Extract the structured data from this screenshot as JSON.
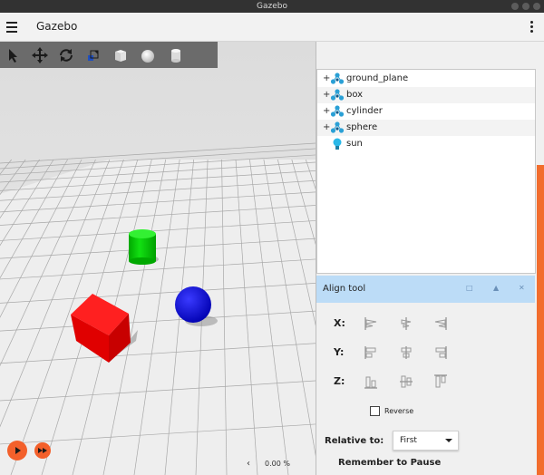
{
  "window": {
    "title": "Gazebo"
  },
  "app": {
    "name": "Gazebo"
  },
  "toolbar": {
    "tools": [
      "select-icon",
      "translate-icon",
      "rotate-icon",
      "scale-icon",
      "box-icon",
      "sphere-icon",
      "cylinder-icon"
    ]
  },
  "playback": {
    "rtf": "0.00 %",
    "collapse_arrow": "‹"
  },
  "entity_tree": {
    "items": [
      {
        "label": "ground_plane",
        "expandable": true,
        "icon": "model-icon"
      },
      {
        "label": "box",
        "expandable": true,
        "icon": "model-icon"
      },
      {
        "label": "cylinder",
        "expandable": true,
        "icon": "model-icon"
      },
      {
        "label": "sphere",
        "expandable": true,
        "icon": "model-icon"
      },
      {
        "label": "sun",
        "expandable": false,
        "icon": "light-icon"
      }
    ]
  },
  "align_tool": {
    "title": "Align tool",
    "header_buttons": [
      "□",
      "▲",
      "✕"
    ],
    "axes": [
      "X:",
      "Y:",
      "Z:"
    ],
    "reverse_label": "Reverse",
    "relative_label": "Relative to:",
    "relative_value": "First",
    "remember_label": "Remember to Pause"
  },
  "colors": {
    "accent": "#f3602b",
    "panel_header": "#bcdcf7",
    "box": "#ff0000",
    "cylinder": "#00c800",
    "sphere": "#0000e0"
  }
}
